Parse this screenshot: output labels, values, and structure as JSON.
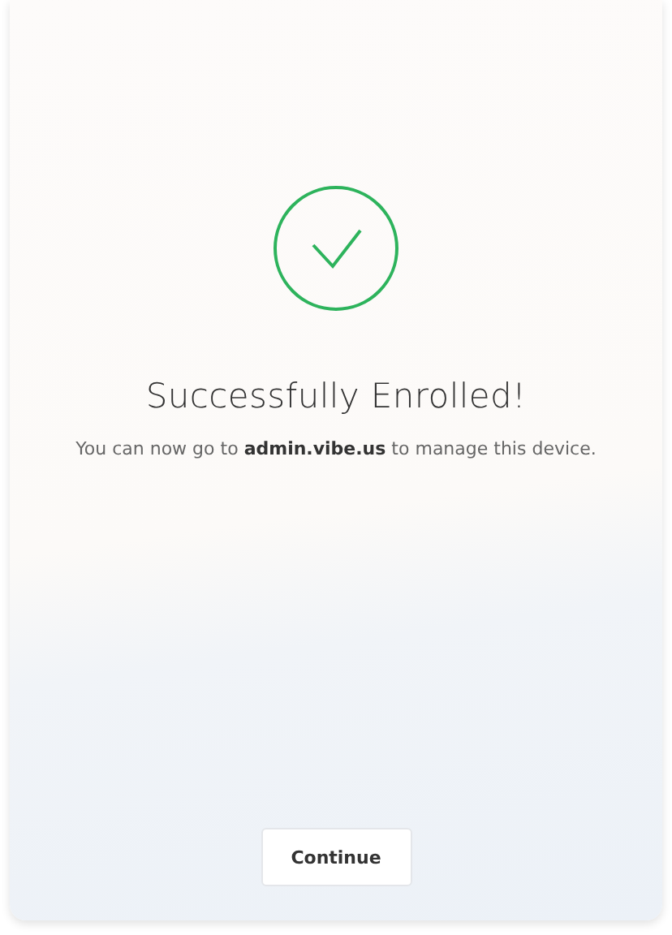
{
  "title": "Successfully Enrolled!",
  "message": "You can now go to **admin.vibe.us** to manage this device.",
  "button": {
    "label": "Continue"
  }
}
